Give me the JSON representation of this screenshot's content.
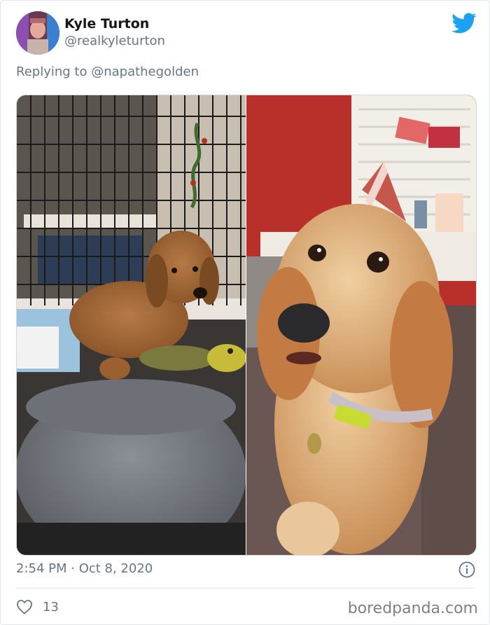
{
  "tweet": {
    "author_name": "Kyle Turton",
    "author_handle": "@realkyleturton",
    "replying_to": "Replying to @napathegolden",
    "timestamp": "2:54 PM · Oct 8, 2020",
    "like_count": "13"
  },
  "icons": {
    "brand": "twitter-bird-icon",
    "info": "info-icon",
    "like": "heart-icon"
  },
  "colors": {
    "twitter_blue": "#1da1f2",
    "secondary_text": "#657786"
  },
  "watermark": "boredpanda.com"
}
